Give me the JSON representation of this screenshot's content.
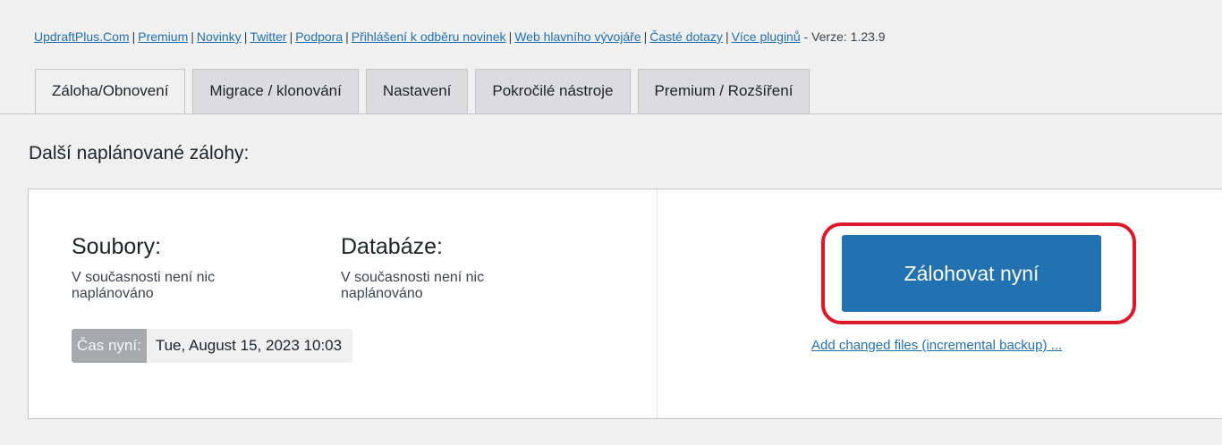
{
  "header_links": {
    "items": [
      "UpdraftPlus.Com",
      "Premium",
      "Novinky",
      "Twitter",
      "Podpora",
      "Přihlášení k odběru novinek",
      "Web hlavního vývojáře",
      "Časté dotazy",
      "Více pluginů"
    ],
    "version": "- Verze: 1.23.9"
  },
  "tabs": [
    {
      "label": "Záloha/Obnovení",
      "active": true
    },
    {
      "label": "Migrace / klonování",
      "active": false
    },
    {
      "label": "Nastavení",
      "active": false
    },
    {
      "label": "Pokročilé nástroje",
      "active": false
    },
    {
      "label": "Premium / Rozšíření",
      "active": false
    }
  ],
  "section": {
    "title": "Další naplánované zálohy:"
  },
  "schedule": {
    "files": {
      "heading": "Soubory:",
      "status": "V současnosti není nic naplánováno"
    },
    "database": {
      "heading": "Databáze:",
      "status": "V současnosti není nic naplánováno"
    },
    "time_now": {
      "label": "Čas nyní:",
      "value": "Tue, August 15, 2023 10:03"
    }
  },
  "actions": {
    "backup_now_label": "Zálohovat nyní",
    "incremental_link": "Add changed files (incremental backup) ..."
  },
  "colors": {
    "accent": "#2271b1",
    "highlight": "#e0162b",
    "background": "#f0f0f1"
  }
}
